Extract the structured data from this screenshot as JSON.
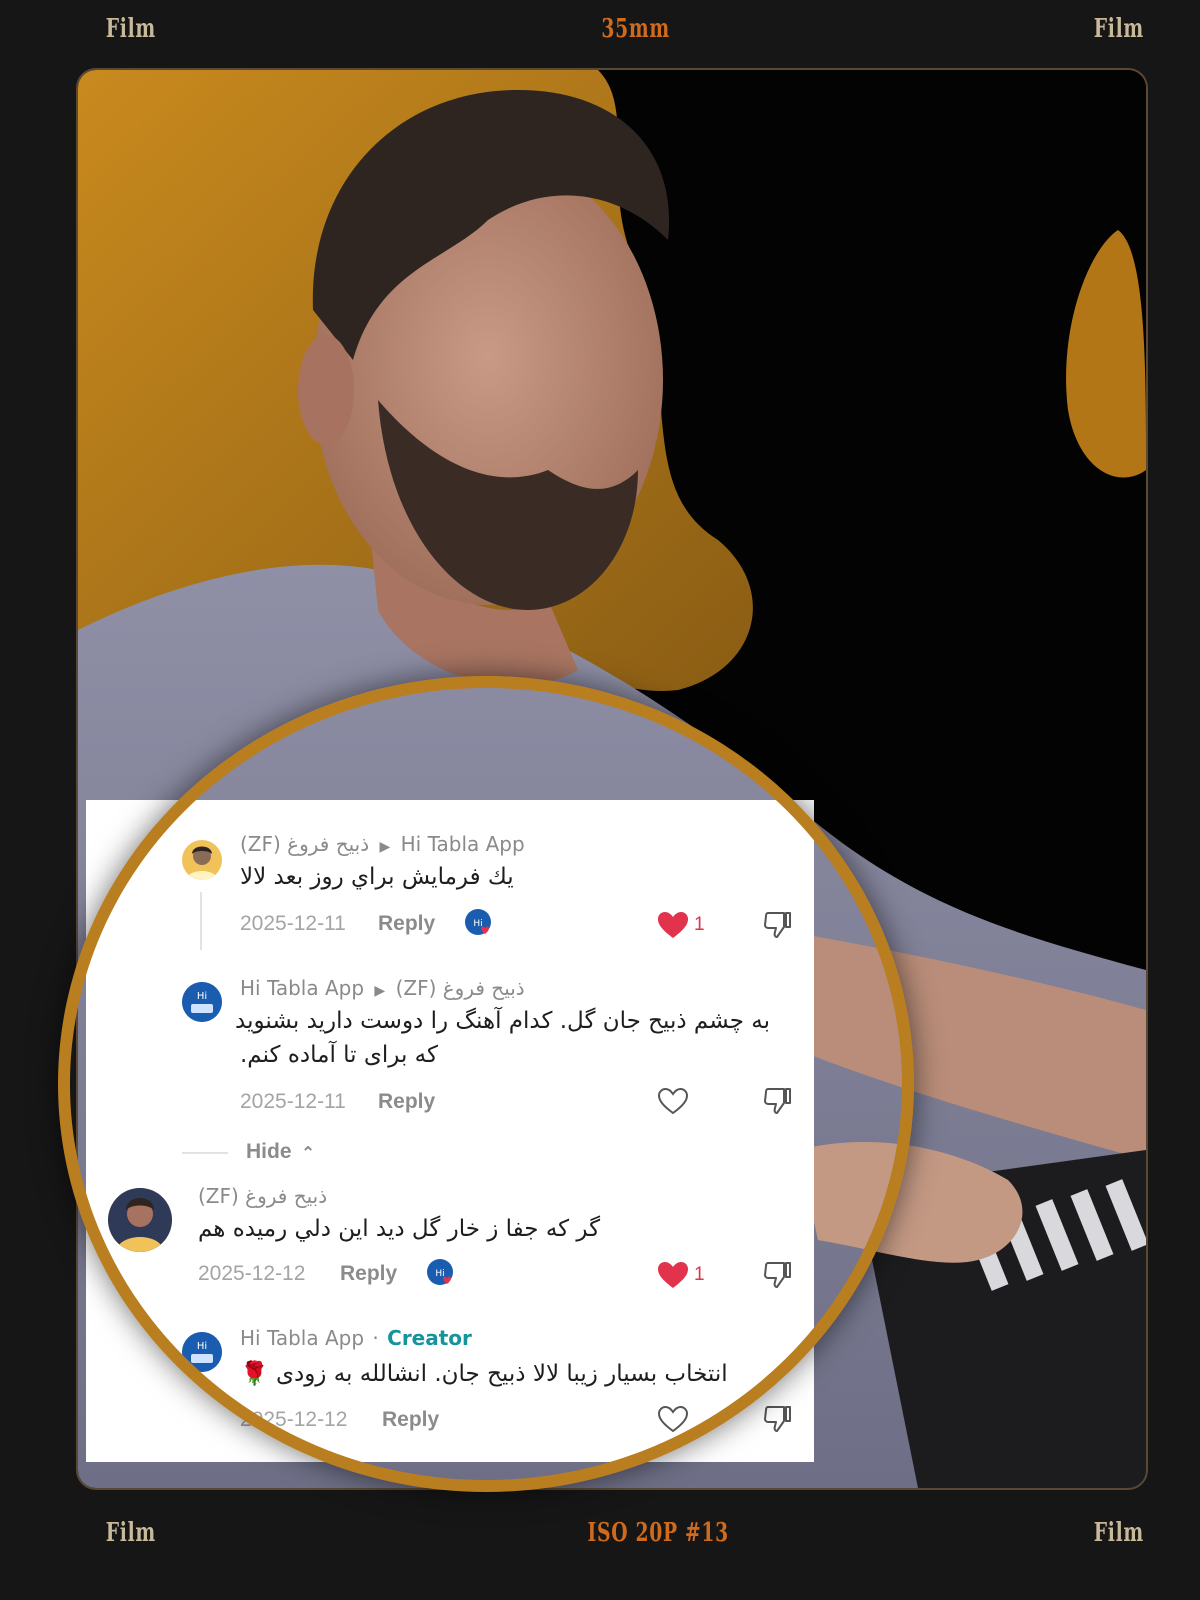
{
  "frame": {
    "top_left": "Film",
    "top_center": "35mm",
    "top_right": "Film",
    "bottom_left": "Film",
    "bottom_center": "ISO 20P #13",
    "bottom_right": "Film"
  },
  "colors": {
    "accent": "#b97e1f",
    "like": "#e2334c",
    "creator": "#17939b",
    "frame_text": "#c8b99a",
    "frame_orange": "#d06a1c"
  },
  "comments": [
    {
      "author": "(ZF) ذبیح فروغ",
      "reply_to": "Hi Tabla App",
      "text": "يك فرمايش براي روز بعد لالا",
      "date": "2025-12-11",
      "reply_label": "Reply",
      "likes": "1",
      "liked": true,
      "creator_liked": true
    },
    {
      "author": "Hi Tabla App",
      "reply_to": "(ZF) ذبیح فروغ",
      "text_line1": "به چشم ذبیح جان گل. کدام آهنگ را دوست دارید بشنوید",
      "text_line2": "که برای تا آماده کنم.",
      "date": "2025-12-11",
      "reply_label": "Reply",
      "liked": false
    },
    {
      "author": "(ZF) ذبیح فروغ",
      "text": "گر که جفا ز خار گل دید این دلي رمیده هم",
      "date": "2025-12-12",
      "reply_label": "Reply",
      "likes": "1",
      "liked": true,
      "creator_liked": true
    },
    {
      "author": "Hi Tabla App",
      "creator_sep": "·",
      "creator_badge": "Creator",
      "text": "انتخاب بسیار زیبا لالا ذبیح جان. انشالله به زودی 🌹",
      "date": "2025-12-12",
      "reply_label": "Reply",
      "liked": false
    }
  ],
  "hide_label": "Hide",
  "icons": {
    "heart_filled": "heart-filled-icon",
    "heart_outline": "heart-outline-icon",
    "dislike": "thumbs-down-icon",
    "chevron": "chevron-up-icon",
    "arrow": "play-arrow-icon"
  }
}
